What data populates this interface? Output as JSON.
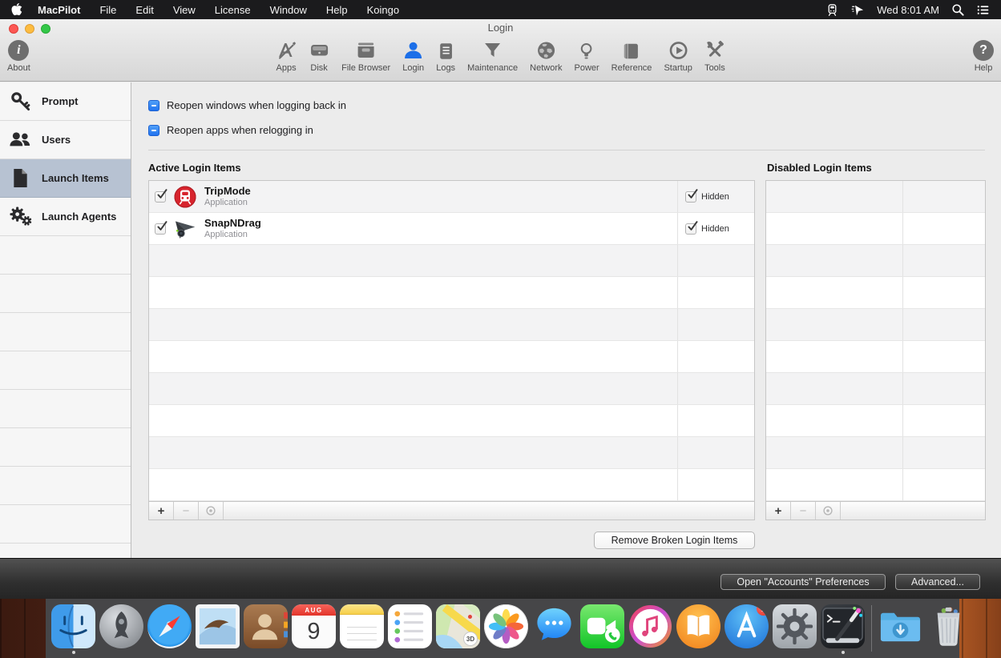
{
  "menu_bar": {
    "app_name": "MacPilot",
    "menus": [
      "File",
      "Edit",
      "View",
      "License",
      "Window",
      "Help",
      "Koingo"
    ],
    "clock": "Wed 8:01 AM"
  },
  "window": {
    "title": "Login",
    "toolbar": {
      "about_label": "About",
      "help_label": "Help",
      "items": [
        {
          "label": "Apps",
          "icon": "apps-icon"
        },
        {
          "label": "Disk",
          "icon": "disk-icon"
        },
        {
          "label": "File Browser",
          "icon": "file-browser-icon"
        },
        {
          "label": "Login",
          "icon": "login-user-icon",
          "active": true
        },
        {
          "label": "Logs",
          "icon": "logs-icon"
        },
        {
          "label": "Maintenance",
          "icon": "funnel-icon"
        },
        {
          "label": "Network",
          "icon": "globe-icon"
        },
        {
          "label": "Power",
          "icon": "lightbulb-icon"
        },
        {
          "label": "Reference",
          "icon": "book-icon"
        },
        {
          "label": "Startup",
          "icon": "play-circle-icon"
        },
        {
          "label": "Tools",
          "icon": "tools-icon"
        }
      ]
    },
    "sidebar": {
      "items": [
        {
          "label": "Prompt",
          "icon": "key-icon"
        },
        {
          "label": "Users",
          "icon": "users-icon"
        },
        {
          "label": "Launch Items",
          "icon": "document-icon",
          "selected": true
        },
        {
          "label": "Launch Agents",
          "icon": "gears-icon"
        }
      ],
      "empty_rows": 9
    },
    "options": [
      {
        "label": "Reopen windows when logging back in",
        "state": "mixed"
      },
      {
        "label": "Reopen apps when relogging in",
        "state": "mixed"
      }
    ],
    "active_table": {
      "title": "Active Login Items",
      "rows": [
        {
          "enabled": true,
          "icon": "tripmode-app-icon",
          "name": "TripMode",
          "kind": "Application",
          "hidden": true,
          "hidden_label": "Hidden"
        },
        {
          "enabled": true,
          "icon": "snapndrag-app-icon",
          "name": "SnapNDrag",
          "kind": "Application",
          "hidden": true,
          "hidden_label": "Hidden"
        }
      ],
      "empty_rows": 8
    },
    "disabled_table": {
      "title": "Disabled Login Items",
      "empty_rows": 10
    },
    "remove_broken_button": "Remove Broken Login Items",
    "bottom_bar": {
      "accounts_button": "Open \"Accounts\" Preferences",
      "advanced_button": "Advanced..."
    }
  },
  "dock": {
    "items": [
      {
        "icon": "finder-icon",
        "running": true
      },
      {
        "icon": "launchpad-icon"
      },
      {
        "icon": "safari-icon"
      },
      {
        "icon": "mail-icon"
      },
      {
        "icon": "contacts-icon"
      },
      {
        "icon": "calendar-icon",
        "month": "AUG",
        "day": "9"
      },
      {
        "icon": "notes-icon"
      },
      {
        "icon": "reminders-icon"
      },
      {
        "icon": "maps-icon",
        "overlay": "3D"
      },
      {
        "icon": "photos-icon"
      },
      {
        "icon": "messages-icon"
      },
      {
        "icon": "facetime-icon"
      },
      {
        "icon": "itunes-icon"
      },
      {
        "icon": "ibooks-icon"
      },
      {
        "icon": "app-store-icon",
        "badge": "1"
      },
      {
        "icon": "system-preferences-icon"
      },
      {
        "icon": "macpilot-dock-icon",
        "running": true
      },
      {
        "icon": "dock-separator",
        "separator": true
      },
      {
        "icon": "downloads-folder-icon"
      },
      {
        "icon": "trash-icon"
      }
    ]
  },
  "colors": {
    "accent_blue": "#1c6fe8",
    "menu_bar_bg": "#1b1b1d",
    "sidebar_selected_bg": "#b7c2d2",
    "checkbox_blue": "#2d7ff0",
    "tripmode_red": "#d7242d"
  }
}
